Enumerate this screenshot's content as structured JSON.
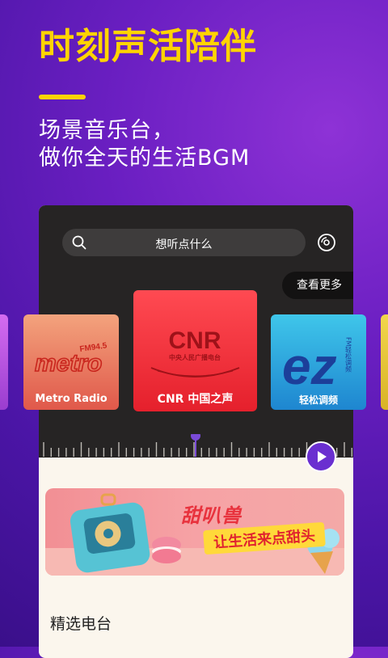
{
  "promo": {
    "headline": "时刻声活陪伴",
    "subline_1": "场景音乐台，",
    "subline_2": "做你全天的生活BGM"
  },
  "app": {
    "search": {
      "placeholder": "想听点什么"
    },
    "more_label": "查看更多",
    "stations": [
      {
        "label": "Metro Radio",
        "logo_text": "metro",
        "logo_badge": "FM94.5"
      },
      {
        "label": "CNR 中国之声",
        "logo_text": "CNR",
        "logo_sub": "中央人民广播电台"
      },
      {
        "label": "轻松调频",
        "logo_text": "ez",
        "logo_vertical": "FM轻松调频"
      }
    ],
    "banner": {
      "title": "甜叭兽",
      "slogan": "让生活来点甜头"
    },
    "section_title": "精选电台"
  },
  "colors": {
    "accent_yellow": "#ffd400",
    "background_purple": "#6b1fc2",
    "dark_panel": "#262424",
    "cnr_red": "#e5202c",
    "play_purple": "#6a2fd0"
  },
  "icons": [
    "search-icon",
    "disc-icon",
    "play-icon"
  ]
}
